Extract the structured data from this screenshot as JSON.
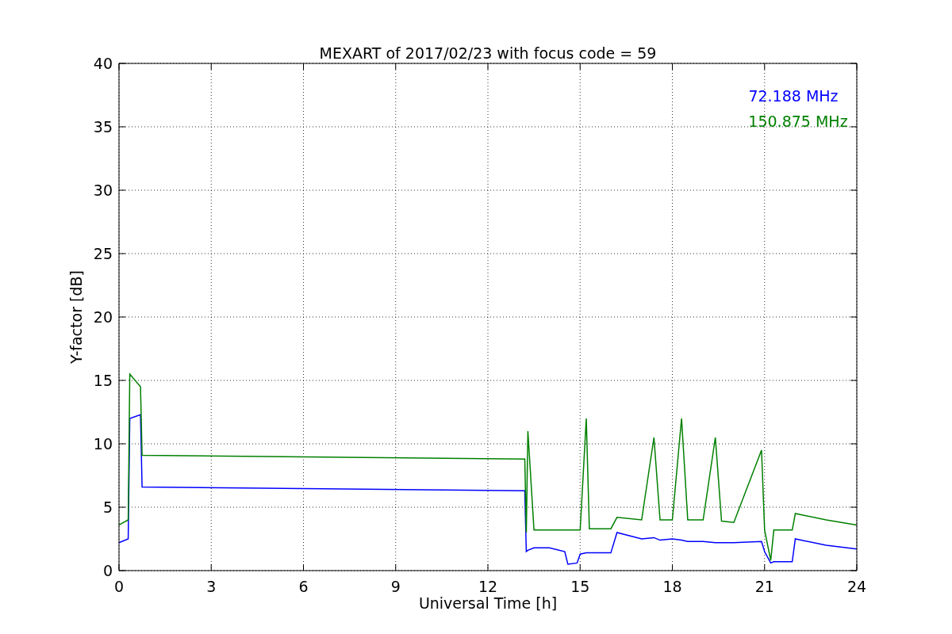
{
  "chart_data": {
    "type": "line",
    "title": "MEXART of 2017/02/23 with focus code = 59",
    "xlabel": "Universal Time [h]",
    "ylabel": "Y-factor [dB]",
    "x": [
      0,
      0.3,
      0.35,
      0.7,
      0.75,
      13.2,
      13.25,
      13.3,
      13.5,
      14,
      14.5,
      14.6,
      14.9,
      15,
      15.2,
      15.3,
      16,
      16.2,
      17,
      17.4,
      17.6,
      18,
      18.3,
      18.5,
      19,
      19.4,
      19.6,
      20,
      20.9,
      21,
      21.2,
      21.3,
      21.9,
      22,
      23,
      24
    ],
    "series": [
      {
        "name": "72.188 MHz",
        "color": "#0000ff",
        "values": [
          2.2,
          2.5,
          12,
          12.3,
          6.6,
          6.3,
          1.5,
          1.6,
          1.8,
          1.8,
          1.5,
          0.5,
          0.6,
          1.3,
          1.4,
          1.4,
          1.4,
          3,
          2.5,
          2.6,
          2.4,
          2.5,
          2.4,
          2.3,
          2.3,
          2.2,
          2.2,
          2.2,
          2.3,
          1.5,
          0.6,
          0.7,
          0.7,
          2.5,
          2,
          1.7
        ]
      },
      {
        "name": "150.875 MHz",
        "color": "#008000",
        "values": [
          3.6,
          4,
          15.5,
          14.5,
          9.1,
          8.8,
          3,
          11,
          3.2,
          3.2,
          3.2,
          3.2,
          3.2,
          3.2,
          12,
          3.3,
          3.3,
          4.2,
          4,
          10.5,
          4,
          4,
          12,
          4,
          4,
          10.5,
          3.9,
          3.8,
          9.5,
          3.2,
          0.8,
          3.2,
          3.2,
          4.5,
          4,
          3.6
        ]
      }
    ],
    "xlim": [
      0,
      24
    ],
    "ylim": [
      0,
      40
    ],
    "xticks": [
      0,
      3,
      6,
      9,
      12,
      15,
      18,
      21,
      24
    ],
    "yticks": [
      0,
      5,
      10,
      15,
      20,
      25,
      30,
      35,
      40
    ],
    "grid": true
  }
}
